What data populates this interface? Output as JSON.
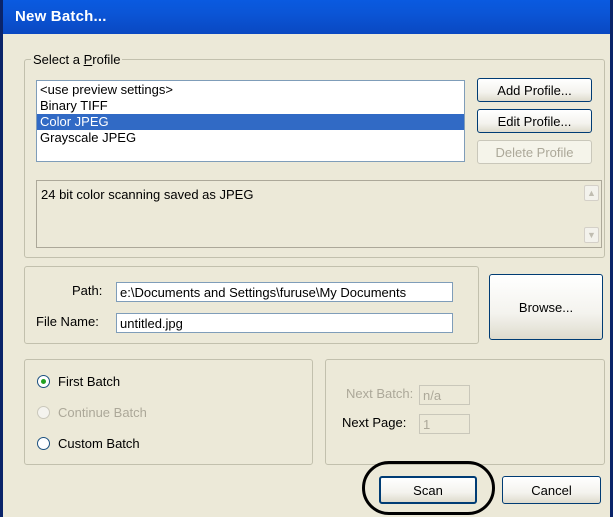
{
  "window": {
    "title": "New Batch..."
  },
  "profile_group": {
    "legend": "Select a Profile",
    "items": [
      "<use preview settings>",
      "Binary TIFF",
      "Color JPEG",
      "Grayscale JPEG"
    ],
    "selected_index": 2,
    "add_label": "Add Profile...",
    "edit_label": "Edit Profile...",
    "delete_label": "Delete Profile",
    "description": "24 bit color scanning saved as JPEG"
  },
  "file_group": {
    "path_label": "Path:",
    "path_value": "e:\\Documents and Settings\\furuse\\My Documents",
    "filename_label": "File Name:",
    "filename_value": "untitled.jpg",
    "browse_label": "Browse..."
  },
  "batch_group": {
    "first_batch": "First Batch",
    "continue_batch": "Continue Batch",
    "custom_batch": "Custom Batch",
    "selected": "first_batch"
  },
  "next_group": {
    "next_batch_label": "Next Batch:",
    "next_batch_value": "n/a",
    "next_page_label": "Next Page:",
    "next_page_value": "1"
  },
  "footer": {
    "scan_label": "Scan",
    "cancel_label": "Cancel"
  },
  "colors": {
    "titlebar": "#0a52d8",
    "selection": "#316ac5",
    "dialog_bg": "#ece9d8"
  }
}
